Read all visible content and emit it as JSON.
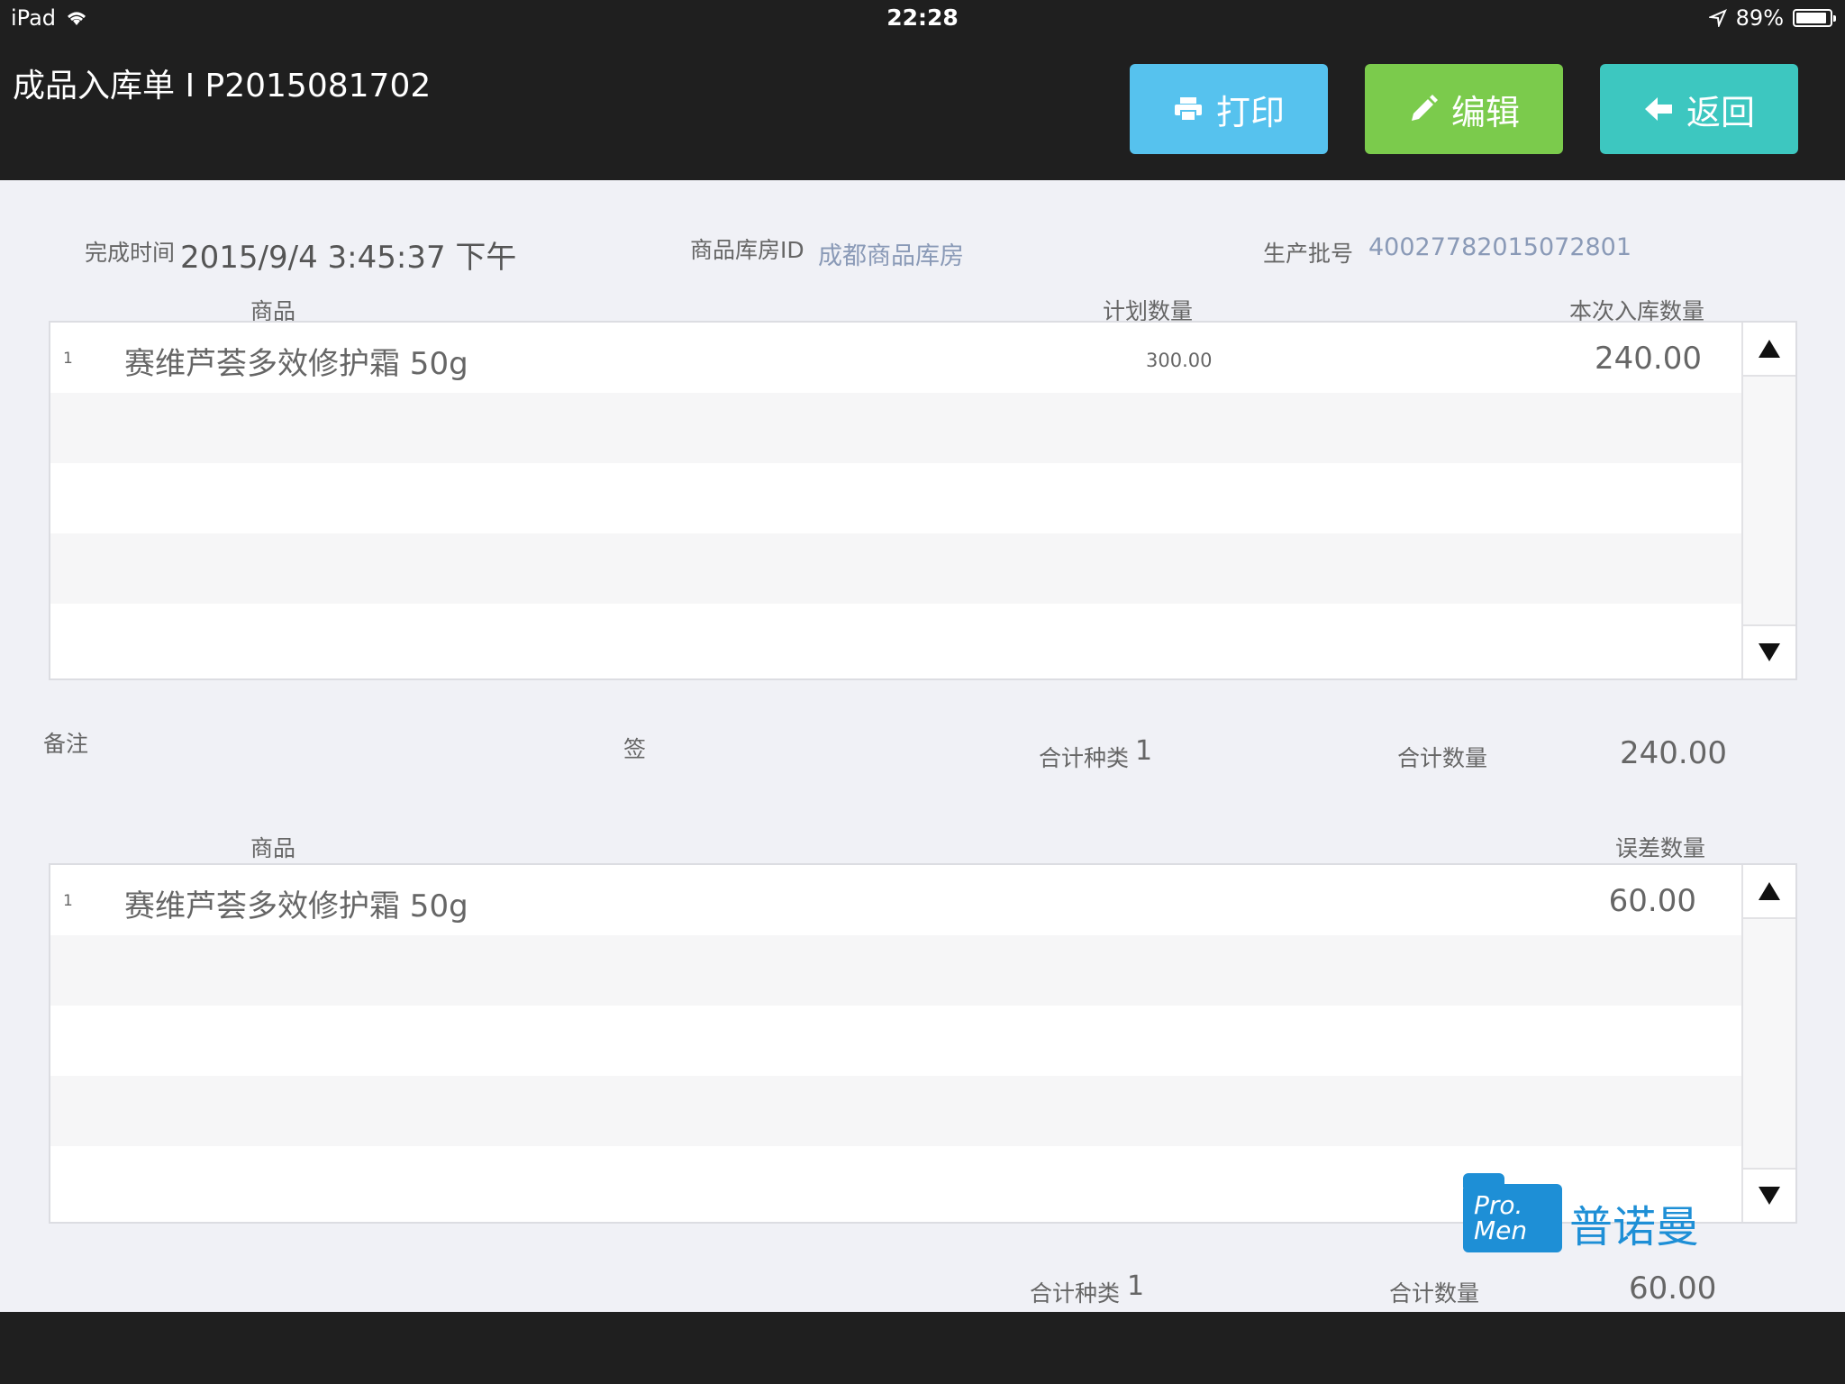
{
  "status_bar": {
    "device": "iPad",
    "time": "22:28",
    "battery": "89%"
  },
  "header": {
    "title": "成品入库单 I P2015081702",
    "print_label": "打印",
    "edit_label": "编辑",
    "back_label": "返回"
  },
  "info": {
    "complete_time_label": "完成时间",
    "complete_time_value": "2015/9/4 3:45:37 下午",
    "warehouse_label": "商品库房ID",
    "warehouse_value": "成都商品库房",
    "batch_label": "生产批号",
    "batch_value": "40027782015072801"
  },
  "table1": {
    "col_product": "商品",
    "col_planned": "计划数量",
    "col_inbound": "本次入库数量",
    "rows": [
      {
        "index": "1",
        "product": "赛维芦荟多效修护霜 50g",
        "planned": "300.00",
        "inbound": "240.00"
      }
    ]
  },
  "summary1": {
    "remark_label": "备注",
    "sign_label": "签",
    "total_kinds_label": "合计种类",
    "total_kinds_value": "1",
    "total_qty_label": "合计数量",
    "total_qty_value": "240.00"
  },
  "table2": {
    "col_product": "商品",
    "col_diff": "误差数量",
    "rows": [
      {
        "index": "1",
        "product": "赛维芦荟多效修护霜 50g",
        "diff": "60.00"
      }
    ]
  },
  "summary2": {
    "total_kinds_label": "合计种类",
    "total_kinds_value": "1",
    "total_qty_label": "合计数量",
    "total_qty_value": "60.00"
  },
  "logo": {
    "line1": "Pro.",
    "line2": "Men",
    "cn": "普诺曼"
  },
  "colors": {
    "print": "#56c2ee",
    "edit": "#7bcb4c",
    "back": "#3dc7c0",
    "logo": "#1e8fd6"
  }
}
